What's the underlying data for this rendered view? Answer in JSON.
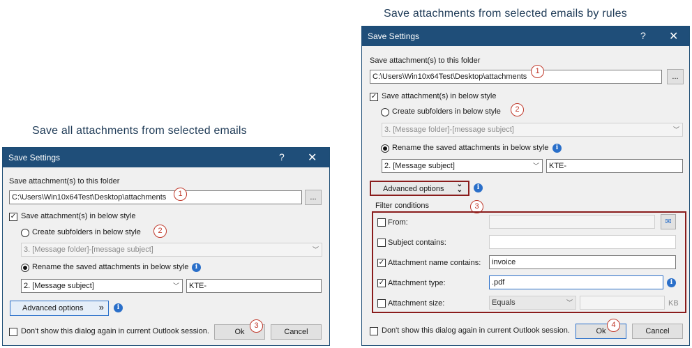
{
  "captions": {
    "left": "Save all attachments from selected emails",
    "right": "Save attachments from selected emails by rules"
  },
  "left_dialog": {
    "title": "Save Settings",
    "help": "?",
    "close": "✕",
    "folder_label": "Save attachment(s) to this folder",
    "folder_path": "C:\\Users\\Win10x64Test\\Desktop\\attachments",
    "browse": "...",
    "save_style_label": "Save attachment(s) in below style",
    "save_style_checked": "✓",
    "subfolder_label": "Create subfolders in below style",
    "subfolder_value": "3. [Message folder]-[message subject]",
    "rename_label": "Rename the saved attachments in below style",
    "rename_value": "2. [Message subject]",
    "prefix": "KTE-",
    "advanced": "Advanced options",
    "advanced_arrow": "»",
    "dont_show": "Don't show this dialog again in current Outlook session.",
    "ok": "Ok",
    "cancel": "Cancel",
    "markers": [
      "1",
      "2",
      "3"
    ]
  },
  "right_dialog": {
    "title": "Save Settings",
    "help": "?",
    "close": "✕",
    "folder_label": "Save attachment(s) to this folder",
    "folder_path": "C:\\Users\\Win10x64Test\\Desktop\\attachments",
    "browse": "...",
    "save_style_label": "Save attachment(s) in below style",
    "save_style_checked": "✓",
    "subfolder_label": "Create subfolders in below style",
    "subfolder_value": "3. [Message folder]-[message subject]",
    "rename_label": "Rename the saved attachments in below style",
    "rename_value": "2. [Message subject]",
    "prefix": "KTE-",
    "advanced": "Advanced options",
    "advanced_arrow": "»",
    "filter_title": "Filter conditions",
    "filters": {
      "from": {
        "label": "From:",
        "checked": "",
        "value": ""
      },
      "subject": {
        "label": "Subject contains:",
        "checked": "",
        "value": ""
      },
      "attach_name": {
        "label": "Attachment name contains:",
        "checked": "✓",
        "value": "invoice"
      },
      "attach_type": {
        "label": "Attachment type:",
        "checked": "✓",
        "value": ".pdf"
      },
      "attach_size": {
        "label": "Attachment size:",
        "checked": "",
        "operator": "Equals",
        "value": "",
        "unit": "KB"
      }
    },
    "dont_show": "Don't show this dialog again in current Outlook session.",
    "ok": "Ok",
    "cancel": "Cancel",
    "markers": [
      "1",
      "2",
      "3",
      "4"
    ]
  },
  "colors": {
    "titlebar": "#1f4e79",
    "marker": "#c0392b",
    "highlight_border": "#8a1c1c",
    "accent": "#2a6fc9"
  },
  "icons": [
    "help-icon",
    "close-icon",
    "info-icon",
    "dropdown-arrow-icon",
    "contacts-icon",
    "chevron-double-down-icon"
  ]
}
